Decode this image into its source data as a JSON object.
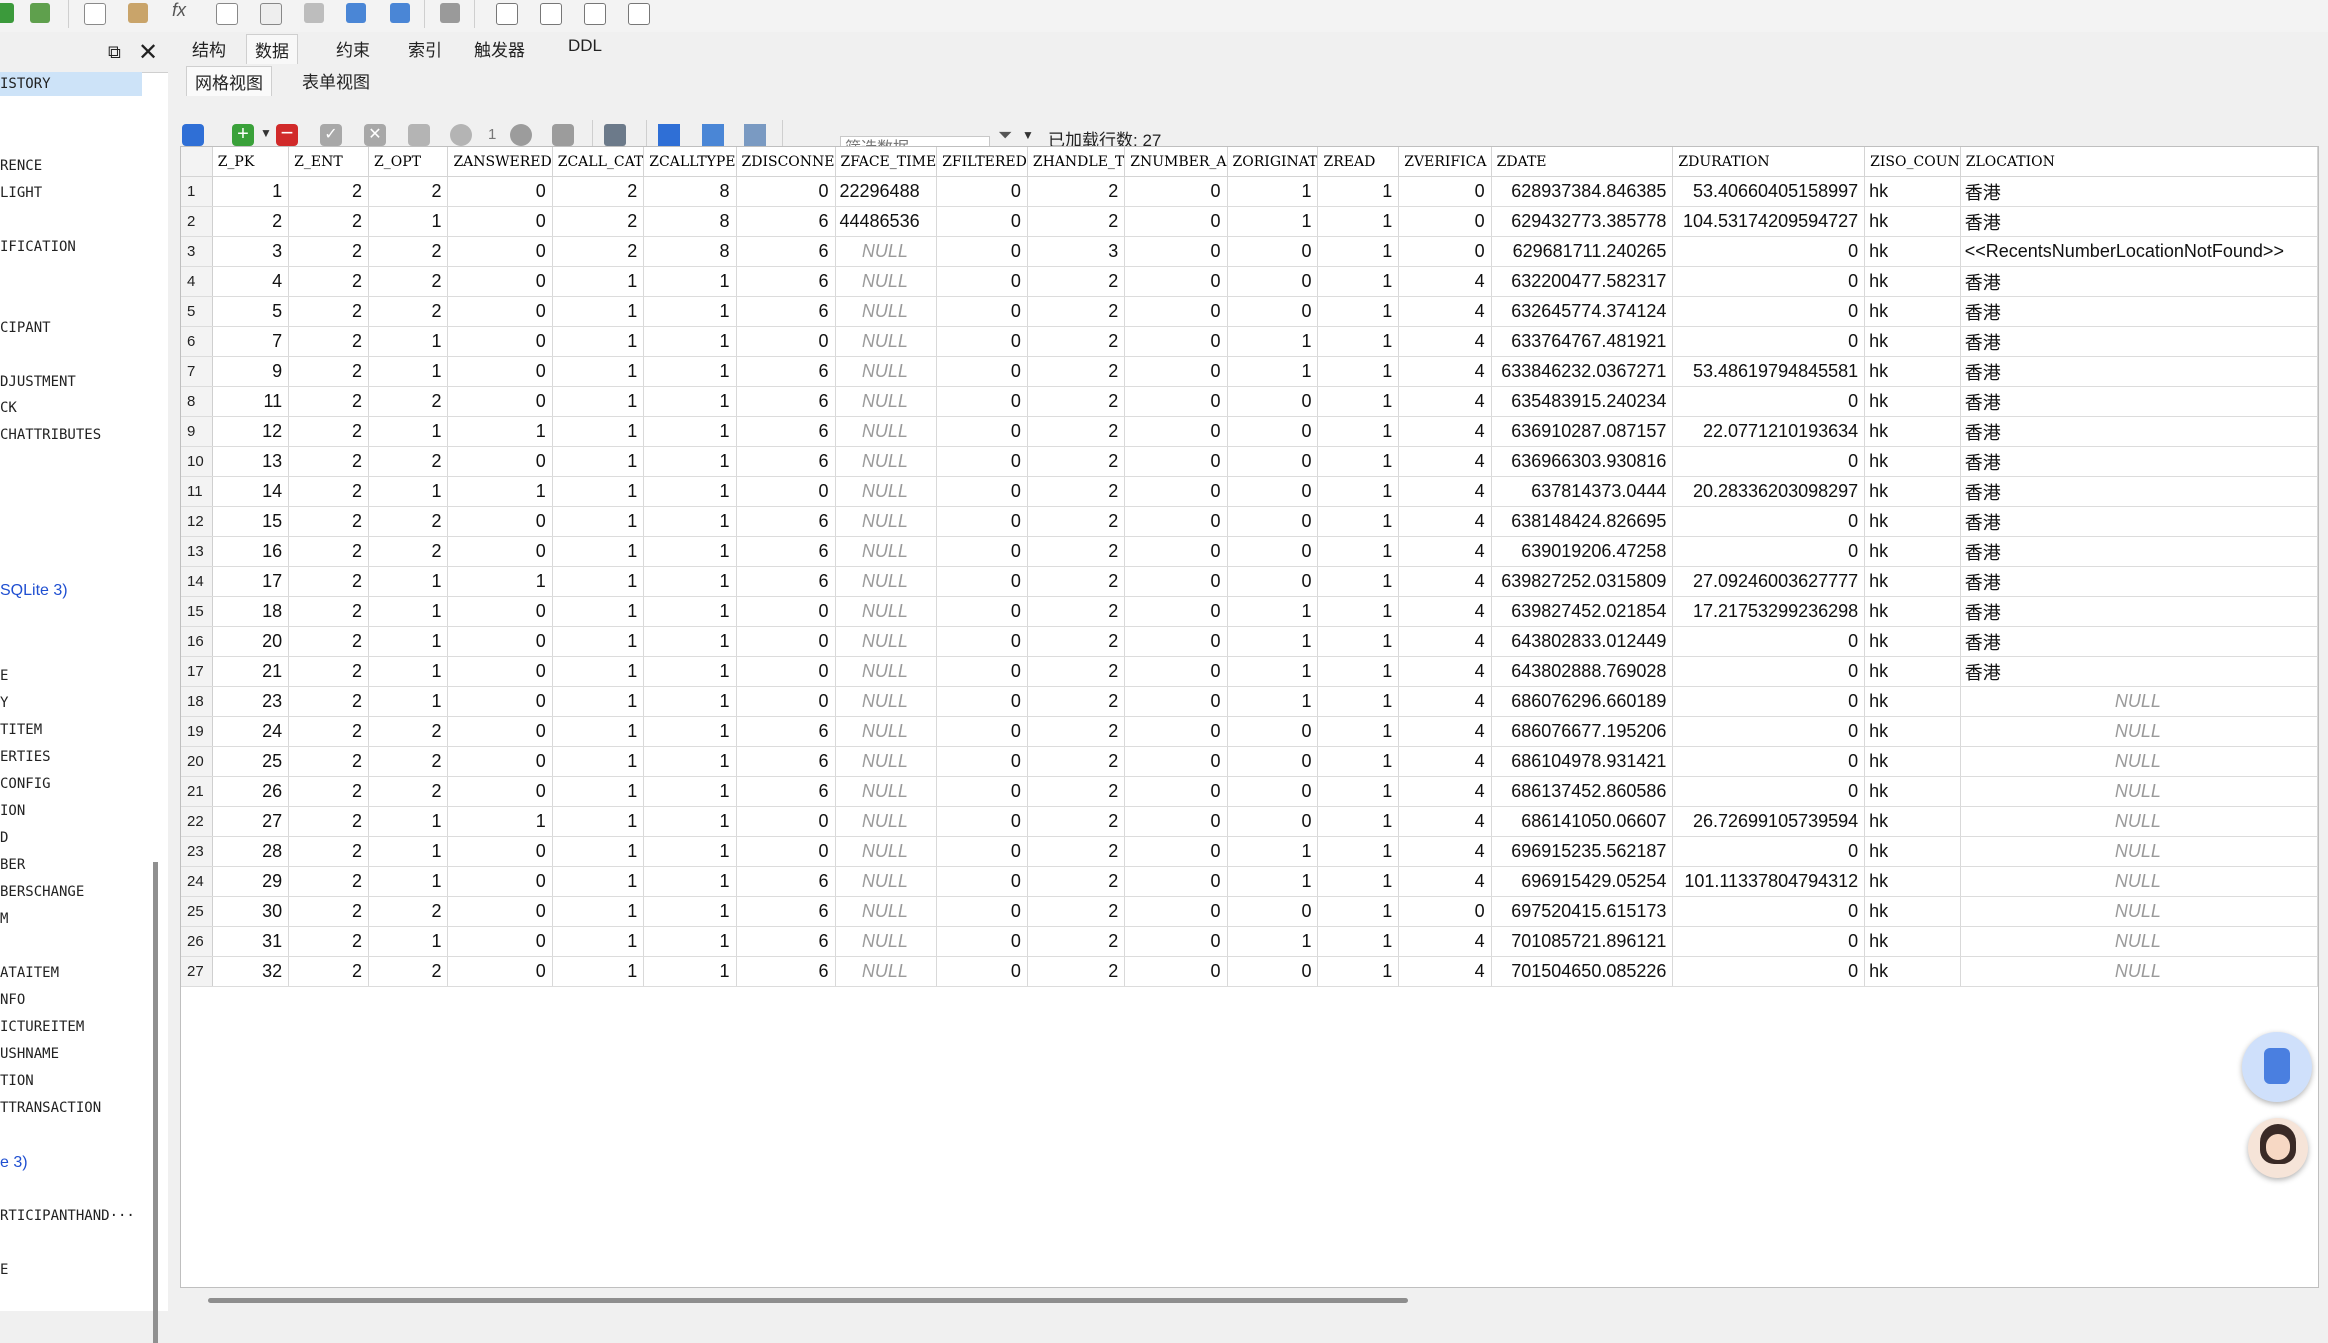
{
  "tabs": [
    "结构",
    "数据",
    "约束",
    "索引",
    "触发器",
    "DDL"
  ],
  "subtabs": [
    "网格视图",
    "表单视图"
  ],
  "filter": {
    "placeholder": "筛选数据"
  },
  "loaded_rows": "已加载行数: 27",
  "page_number": "1",
  "sidebar": {
    "items": [
      {
        "label": "ISTORY",
        "highlight": true
      },
      {
        "label": "RENCE"
      },
      {
        "label": "LIGHT"
      },
      {
        "label": "IFICATION"
      },
      {
        "label": "CIPANT"
      },
      {
        "label": "DJUSTMENT"
      },
      {
        "label": "CK"
      },
      {
        "label": "CHATTRIBUTES"
      },
      {
        "label": "SQLite 3)",
        "blue": true
      },
      {
        "label": "E"
      },
      {
        "label": "Y"
      },
      {
        "label": "TITEM"
      },
      {
        "label": "ERTIES"
      },
      {
        "label": "CONFIG"
      },
      {
        "label": "ION"
      },
      {
        "label": "D"
      },
      {
        "label": "BER"
      },
      {
        "label": "BERSCHANGE"
      },
      {
        "label": "M"
      },
      {
        "label": "ATAITEM"
      },
      {
        "label": "NFO"
      },
      {
        "label": "ICTUREITEM"
      },
      {
        "label": "USHNAME"
      },
      {
        "label": "TION"
      },
      {
        "label": "TTRANSACTION"
      },
      {
        "label": "e 3)",
        "blue": true
      },
      {
        "label": "RTICIPANTHAND···"
      },
      {
        "label": "E"
      }
    ]
  },
  "table": {
    "columns": [
      "Z_PK",
      "Z_ENT",
      "Z_OPT",
      "ZANSWERED",
      "ZCALL_CAT",
      "ZCALLTYPE",
      "ZDISCONNE",
      "ZFACE_TIME",
      "ZFILTERED",
      "ZHANDLE_T",
      "ZNUMBER_A",
      "ZORIGINAT",
      "ZREAD",
      "ZVERIFICA",
      "ZDATE",
      "ZDURATION",
      "ZISO_COUN",
      "ZLOCATION"
    ],
    "null_text": "NULL",
    "rows": [
      [
        "1",
        "2",
        "2",
        "0",
        "2",
        "8",
        "0",
        "22296488",
        "0",
        "2",
        "0",
        "1",
        "1",
        "0",
        "628937384.846385",
        "53.40660405158997",
        "hk",
        "香港"
      ],
      [
        "2",
        "2",
        "1",
        "0",
        "2",
        "8",
        "6",
        "44486536",
        "0",
        "2",
        "0",
        "1",
        "1",
        "0",
        "629432773.385778",
        "104.53174209594727",
        "hk",
        "香港"
      ],
      [
        "3",
        "2",
        "2",
        "0",
        "2",
        "8",
        "6",
        null,
        "0",
        "3",
        "0",
        "0",
        "1",
        "0",
        "629681711.240265",
        "0",
        "hk",
        "<<RecentsNumberLocationNotFound>>"
      ],
      [
        "4",
        "2",
        "2",
        "0",
        "1",
        "1",
        "6",
        null,
        "0",
        "2",
        "0",
        "0",
        "1",
        "4",
        "632200477.582317",
        "0",
        "hk",
        "香港"
      ],
      [
        "5",
        "2",
        "2",
        "0",
        "1",
        "1",
        "6",
        null,
        "0",
        "2",
        "0",
        "0",
        "1",
        "4",
        "632645774.374124",
        "0",
        "hk",
        "香港"
      ],
      [
        "7",
        "2",
        "1",
        "0",
        "1",
        "1",
        "0",
        null,
        "0",
        "2",
        "0",
        "1",
        "1",
        "4",
        "633764767.481921",
        "0",
        "hk",
        "香港"
      ],
      [
        "9",
        "2",
        "1",
        "0",
        "1",
        "1",
        "6",
        null,
        "0",
        "2",
        "0",
        "1",
        "1",
        "4",
        "633846232.0367271",
        "53.48619794845581",
        "hk",
        "香港"
      ],
      [
        "11",
        "2",
        "2",
        "0",
        "1",
        "1",
        "6",
        null,
        "0",
        "2",
        "0",
        "0",
        "1",
        "4",
        "635483915.240234",
        "0",
        "hk",
        "香港"
      ],
      [
        "12",
        "2",
        "1",
        "1",
        "1",
        "1",
        "6",
        null,
        "0",
        "2",
        "0",
        "0",
        "1",
        "4",
        "636910287.087157",
        "22.0771210193634",
        "hk",
        "香港"
      ],
      [
        "13",
        "2",
        "2",
        "0",
        "1",
        "1",
        "6",
        null,
        "0",
        "2",
        "0",
        "0",
        "1",
        "4",
        "636966303.930816",
        "0",
        "hk",
        "香港"
      ],
      [
        "14",
        "2",
        "1",
        "1",
        "1",
        "1",
        "0",
        null,
        "0",
        "2",
        "0",
        "0",
        "1",
        "4",
        "637814373.0444",
        "20.28336203098297",
        "hk",
        "香港"
      ],
      [
        "15",
        "2",
        "2",
        "0",
        "1",
        "1",
        "6",
        null,
        "0",
        "2",
        "0",
        "0",
        "1",
        "4",
        "638148424.826695",
        "0",
        "hk",
        "香港"
      ],
      [
        "16",
        "2",
        "2",
        "0",
        "1",
        "1",
        "6",
        null,
        "0",
        "2",
        "0",
        "0",
        "1",
        "4",
        "639019206.47258",
        "0",
        "hk",
        "香港"
      ],
      [
        "17",
        "2",
        "1",
        "1",
        "1",
        "1",
        "6",
        null,
        "0",
        "2",
        "0",
        "0",
        "1",
        "4",
        "639827252.0315809",
        "27.09246003627777",
        "hk",
        "香港"
      ],
      [
        "18",
        "2",
        "1",
        "0",
        "1",
        "1",
        "0",
        null,
        "0",
        "2",
        "0",
        "1",
        "1",
        "4",
        "639827452.021854",
        "17.21753299236298",
        "hk",
        "香港"
      ],
      [
        "20",
        "2",
        "1",
        "0",
        "1",
        "1",
        "0",
        null,
        "0",
        "2",
        "0",
        "1",
        "1",
        "4",
        "643802833.012449",
        "0",
        "hk",
        "香港"
      ],
      [
        "21",
        "2",
        "1",
        "0",
        "1",
        "1",
        "0",
        null,
        "0",
        "2",
        "0",
        "1",
        "1",
        "4",
        "643802888.769028",
        "0",
        "hk",
        "香港"
      ],
      [
        "23",
        "2",
        "1",
        "0",
        "1",
        "1",
        "0",
        null,
        "0",
        "2",
        "0",
        "1",
        "1",
        "4",
        "686076296.660189",
        "0",
        "hk",
        null
      ],
      [
        "24",
        "2",
        "2",
        "0",
        "1",
        "1",
        "6",
        null,
        "0",
        "2",
        "0",
        "0",
        "1",
        "4",
        "686076677.195206",
        "0",
        "hk",
        null
      ],
      [
        "25",
        "2",
        "2",
        "0",
        "1",
        "1",
        "6",
        null,
        "0",
        "2",
        "0",
        "0",
        "1",
        "4",
        "686104978.931421",
        "0",
        "hk",
        null
      ],
      [
        "26",
        "2",
        "2",
        "0",
        "1",
        "1",
        "6",
        null,
        "0",
        "2",
        "0",
        "0",
        "1",
        "4",
        "686137452.860586",
        "0",
        "hk",
        null
      ],
      [
        "27",
        "2",
        "1",
        "1",
        "1",
        "1",
        "0",
        null,
        "0",
        "2",
        "0",
        "0",
        "1",
        "4",
        "686141050.06607",
        "26.72699105739594",
        "hk",
        null
      ],
      [
        "28",
        "2",
        "1",
        "0",
        "1",
        "1",
        "0",
        null,
        "0",
        "2",
        "0",
        "1",
        "1",
        "4",
        "696915235.562187",
        "0",
        "hk",
        null
      ],
      [
        "29",
        "2",
        "1",
        "0",
        "1",
        "1",
        "6",
        null,
        "0",
        "2",
        "0",
        "1",
        "1",
        "4",
        "696915429.05254",
        "101.11337804794312",
        "hk",
        null
      ],
      [
        "30",
        "2",
        "2",
        "0",
        "1",
        "1",
        "6",
        null,
        "0",
        "2",
        "0",
        "0",
        "1",
        "0",
        "697520415.615173",
        "0",
        "hk",
        null
      ],
      [
        "31",
        "2",
        "1",
        "0",
        "1",
        "1",
        "6",
        null,
        "0",
        "2",
        "0",
        "1",
        "1",
        "4",
        "701085721.896121",
        "0",
        "hk",
        null
      ],
      [
        "32",
        "2",
        "2",
        "0",
        "1",
        "1",
        "6",
        null,
        "0",
        "2",
        "0",
        "0",
        "1",
        "4",
        "701504650.085226",
        "0",
        "hk",
        null
      ]
    ]
  },
  "colors": {
    "accent": "#2f6fd6",
    "add": "#3aa13a",
    "delete": "#d12a2a",
    "null_text": "#9a9a9a",
    "link": "#1f4fd1"
  }
}
